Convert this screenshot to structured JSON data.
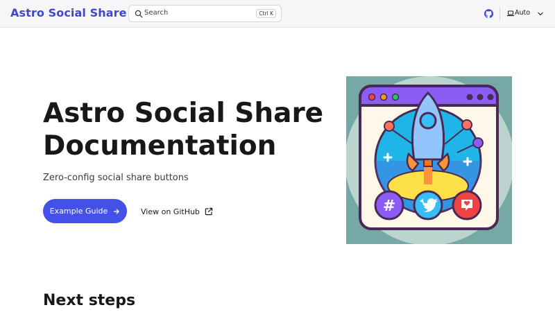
{
  "header": {
    "site_title": "Astro Social Share",
    "search": {
      "placeholder": "Search",
      "shortcut": "Ctrl K"
    },
    "github_icon": "github-icon",
    "theme": {
      "label": "Auto",
      "icon": "laptop-icon",
      "chevron": "chevron-down-icon"
    }
  },
  "hero": {
    "title_line1": "Astro Social Share",
    "title_line2": "Documentation",
    "tagline": "Zero-config social share buttons",
    "primary_action": {
      "label": "Example Guide",
      "icon": "arrow-right-icon"
    },
    "secondary_action": {
      "label": "View on GitHub",
      "icon": "external-link-icon"
    }
  },
  "content": {
    "next_steps_heading": "Next steps"
  },
  "colors": {
    "accent": "#3f48cc",
    "button": "#4451e8",
    "header_bg": "#f6f6f8",
    "illustration_bg": "#76a8a6"
  }
}
